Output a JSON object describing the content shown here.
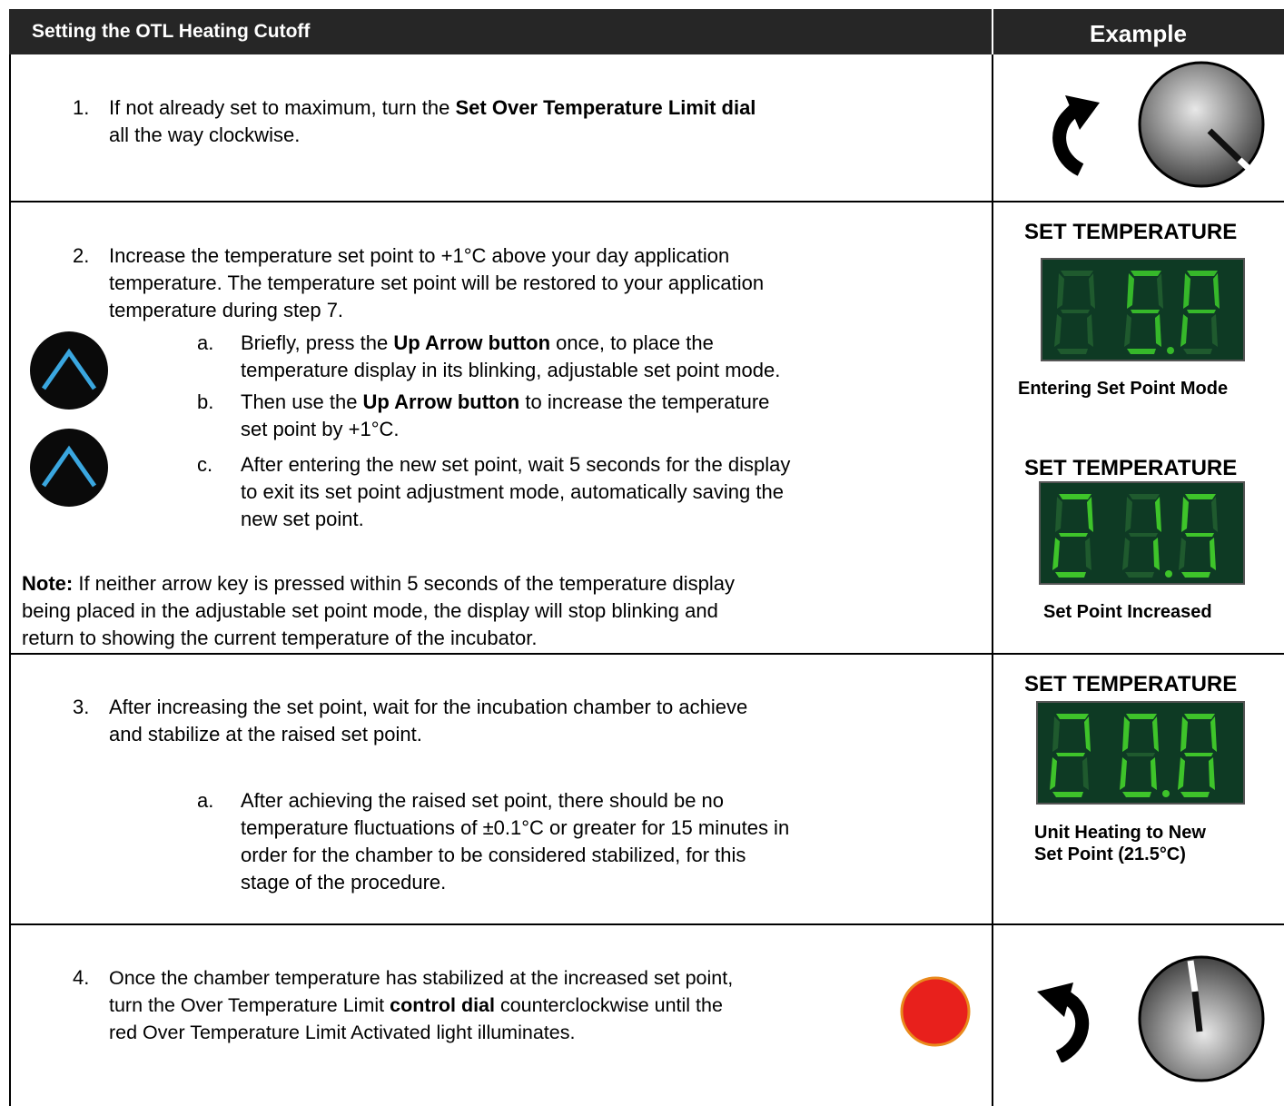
{
  "header": {
    "title": "Setting the OTL Heating Cutoff",
    "example": "Example"
  },
  "step1": {
    "number": "1.",
    "text_a": "If not already set to maximum, turn the ",
    "bold": "Set Over Temperature Limit dial",
    "text_b": "all the way clockwise."
  },
  "step2": {
    "number": "2.",
    "line1": "Increase the temperature set point to +1°C above your day application",
    "line2": "temperature. The temperature set point will be restored to your application",
    "line3": "temperature during step 7.",
    "a_letter": "a.",
    "a_pre": "Briefly, press the ",
    "a_bold": "Up Arrow button",
    "a_post": " once, to place the",
    "a_line2": "temperature display in its blinking, adjustable set point mode.",
    "b_letter": "b.",
    "b_pre": "Then use the ",
    "b_bold": "Up Arrow button",
    "b_post": " to increase the temperature",
    "b_line2": "set point by +1°C.",
    "c_letter": "c.",
    "c_line1": "After entering the new set point, wait 5 seconds for the display",
    "c_line2": "to exit its set point adjustment mode, automatically saving the",
    "c_line3": "new set point.",
    "note_label": "Note:",
    "note_line1": " If neither arrow key is pressed within 5 seconds of the temperature display",
    "note_line2": "being placed in the adjustable set point mode, the display will stop blinking and",
    "note_line3": "return to showing the current temperature of the incubator."
  },
  "step3": {
    "number": "3.",
    "line1": "After increasing the set point, wait for the incubation chamber to achieve",
    "line2": "and stabilize at the raised set point.",
    "a_letter": "a.",
    "a_line1": "After achieving the raised set point, there should be no",
    "a_line2": "temperature fluctuations of ±0.1°C or greater for 15 minutes in",
    "a_line3": "order for the chamber to be considered stabilized, for this",
    "a_line4": "stage of the procedure."
  },
  "step4": {
    "number": "4.",
    "line1": "Once the chamber temperature has stabilized at the increased set point,",
    "pre2": "turn the Over Temperature Limit ",
    "bold2": "control dial",
    "post2": " counterclockwise until the",
    "line3": "red Over Temperature Limit Activated light illuminates."
  },
  "examples": {
    "set_temp_1": "SET TEMPERATURE",
    "cap_1": "Entering Set Point Mode",
    "set_temp_2": "SET TEMPERATURE",
    "cap_2": "Set Point Increased",
    "set_temp_3": "SET TEMPERATURE",
    "cap_3_line1": "Unit Heating to New",
    "cap_3_line2": "Set Point (21.5°C)"
  },
  "displays": {
    "display_1": "SP",
    "display_2": "21.5",
    "display_3": "20.8"
  },
  "colors": {
    "header_bg": "#262626",
    "segment_on_dim": "#2a7a2a",
    "segment_on_bright": "#3ec42a",
    "panel_bg": "#0e3a24",
    "arrow_button_blue": "#3aa7e0",
    "light_red": "#e8201c"
  }
}
